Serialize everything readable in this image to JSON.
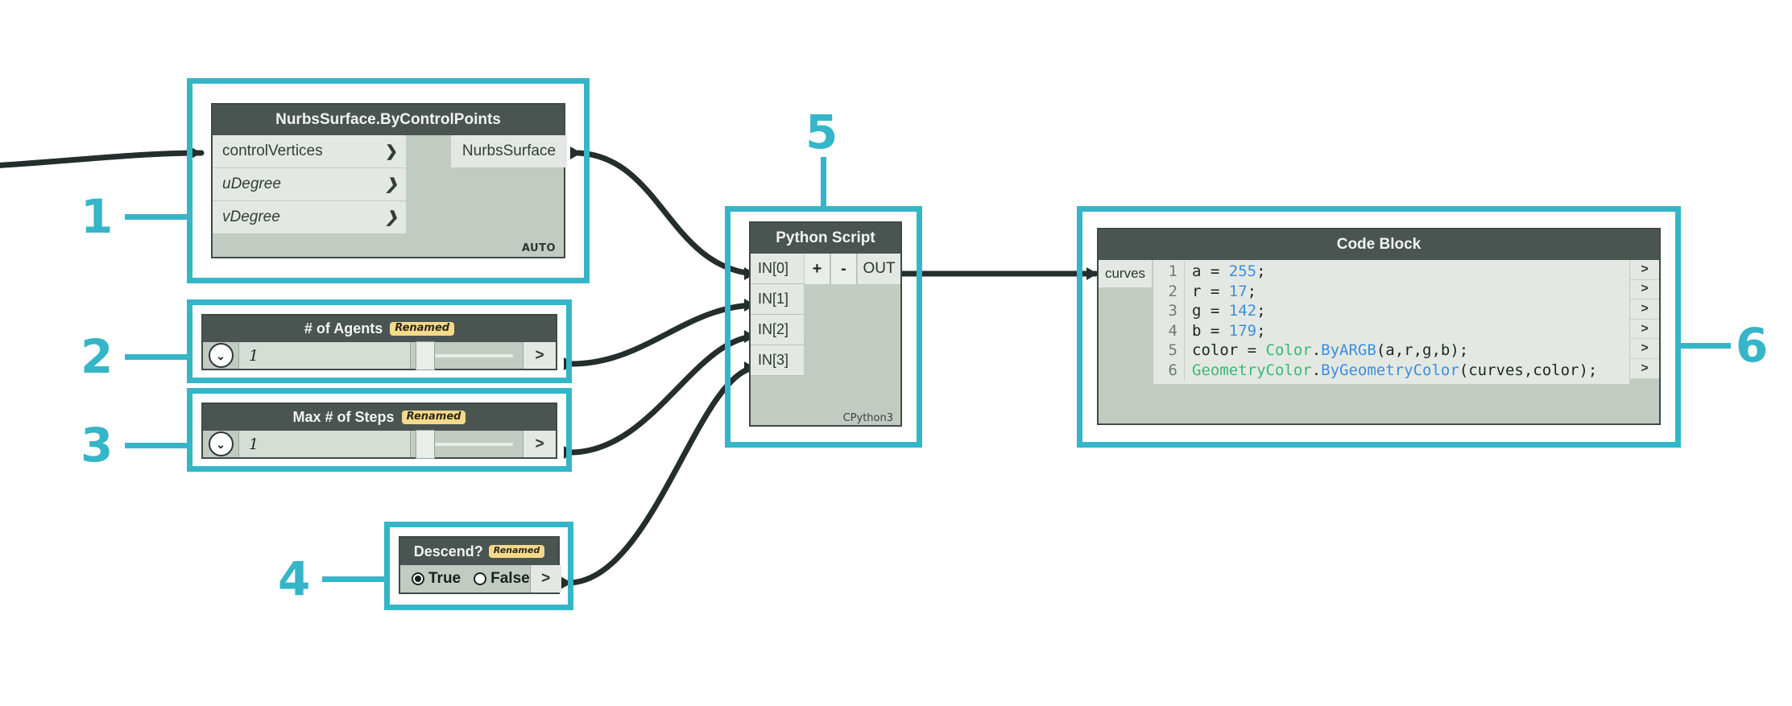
{
  "theme": {
    "accent": "#35b5c8",
    "node_header_bg": "#4a5451",
    "node_body_bg": "#c2cbc2",
    "port_bg": "#e3e9e2",
    "wire_color": "#242e2c",
    "badge_bg": "#f6d98a",
    "code_number_color": "#3f8ddd",
    "code_class_color": "#3cb878"
  },
  "callouts": [
    {
      "id": "1",
      "label": "1"
    },
    {
      "id": "2",
      "label": "2"
    },
    {
      "id": "3",
      "label": "3"
    },
    {
      "id": "4",
      "label": "4"
    },
    {
      "id": "5",
      "label": "5"
    },
    {
      "id": "6",
      "label": "6"
    }
  ],
  "nodes": {
    "nurbs_surface": {
      "title": "NurbsSurface.ByControlPoints",
      "inputs": [
        {
          "label": "controlVertices",
          "italic": false
        },
        {
          "label": "uDegree",
          "italic": true
        },
        {
          "label": "vDegree",
          "italic": true
        }
      ],
      "outputs": [
        {
          "label": "NurbsSurface"
        }
      ],
      "footer": "AUTO",
      "port_chevron": "❯"
    },
    "agents_slider": {
      "title": "# of Agents",
      "badge": "Renamed",
      "value": "1",
      "expander_icon": "⌄",
      "out_chevron": ">"
    },
    "steps_slider": {
      "title": "Max # of Steps",
      "badge": "Renamed",
      "value": "1",
      "expander_icon": "⌄",
      "out_chevron": ">"
    },
    "descend_bool": {
      "title": "Descend?",
      "badge": "Renamed",
      "options": [
        {
          "label": "True",
          "selected": true
        },
        {
          "label": "False",
          "selected": false
        }
      ],
      "out_chevron": ">"
    },
    "python_script": {
      "title": "Python Script",
      "inputs": [
        {
          "label": "IN[0]"
        },
        {
          "label": "IN[1]"
        },
        {
          "label": "IN[2]"
        },
        {
          "label": "IN[3]"
        }
      ],
      "add_button": "+",
      "remove_button": "-",
      "output": "OUT",
      "engine": "CPython3"
    },
    "code_block": {
      "title": "Code Block",
      "input_label": "curves",
      "out_chevron": ">",
      "lines": [
        {
          "n": "1",
          "tokens": [
            {
              "t": "a = ",
              "k": "plain"
            },
            {
              "t": "255",
              "k": "num"
            },
            {
              "t": ";",
              "k": "plain"
            }
          ]
        },
        {
          "n": "2",
          "tokens": [
            {
              "t": "r = ",
              "k": "plain"
            },
            {
              "t": "17",
              "k": "num"
            },
            {
              "t": ";",
              "k": "plain"
            }
          ]
        },
        {
          "n": "3",
          "tokens": [
            {
              "t": "g = ",
              "k": "plain"
            },
            {
              "t": "142",
              "k": "num"
            },
            {
              "t": ";",
              "k": "plain"
            }
          ]
        },
        {
          "n": "4",
          "tokens": [
            {
              "t": "b = ",
              "k": "plain"
            },
            {
              "t": "179",
              "k": "num"
            },
            {
              "t": ";",
              "k": "plain"
            }
          ]
        },
        {
          "n": "5",
          "tokens": [
            {
              "t": "color = ",
              "k": "plain"
            },
            {
              "t": "Color",
              "k": "cls"
            },
            {
              "t": ".",
              "k": "plain"
            },
            {
              "t": "ByARGB",
              "k": "mth"
            },
            {
              "t": "(a,r,g,b);",
              "k": "plain"
            }
          ]
        },
        {
          "n": "6",
          "tokens": [
            {
              "t": "GeometryColor",
              "k": "cls"
            },
            {
              "t": ".",
              "k": "plain"
            },
            {
              "t": "ByGeometryColor",
              "k": "mth"
            },
            {
              "t": "(curves,color);",
              "k": "plain"
            }
          ]
        }
      ]
    }
  }
}
